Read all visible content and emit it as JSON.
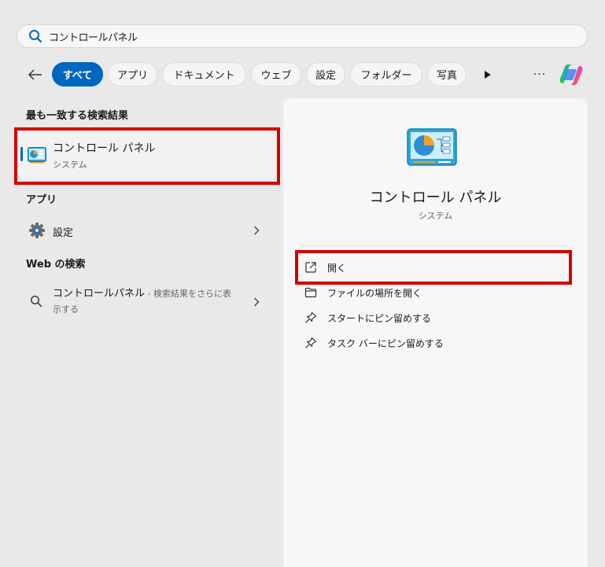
{
  "search": {
    "value": "コントロールパネル",
    "icon": "search-icon"
  },
  "tabs": [
    {
      "label": "すべて",
      "active": true
    },
    {
      "label": "アプリ"
    },
    {
      "label": "ドキュメント"
    },
    {
      "label": "ウェブ"
    },
    {
      "label": "設定"
    },
    {
      "label": "フォルダー"
    },
    {
      "label": "写真"
    }
  ],
  "toolbar": {
    "more_label": "···"
  },
  "left": {
    "best_match_title": "最も一致する検索結果",
    "best_match": {
      "name": "コントロール パネル",
      "sub": "システム"
    },
    "apps_title": "アプリ",
    "apps": [
      {
        "label": "設定"
      }
    ],
    "web_title": "Web の検索",
    "web": {
      "query": "コントロールパネル",
      "suggestion": " - 検索結果をさらに表示する"
    }
  },
  "right": {
    "title": "コントロール パネル",
    "sub": "システム",
    "actions": [
      {
        "label": "開く",
        "icon": "open-external-icon"
      },
      {
        "label": "ファイルの場所を開く",
        "icon": "folder-icon"
      },
      {
        "label": "スタートにピン留めする",
        "icon": "pin-icon"
      },
      {
        "label": "タスク バーにピン留めする",
        "icon": "pin-icon"
      }
    ]
  },
  "colors": {
    "accent": "#0067c0",
    "highlight": "#d40000"
  }
}
